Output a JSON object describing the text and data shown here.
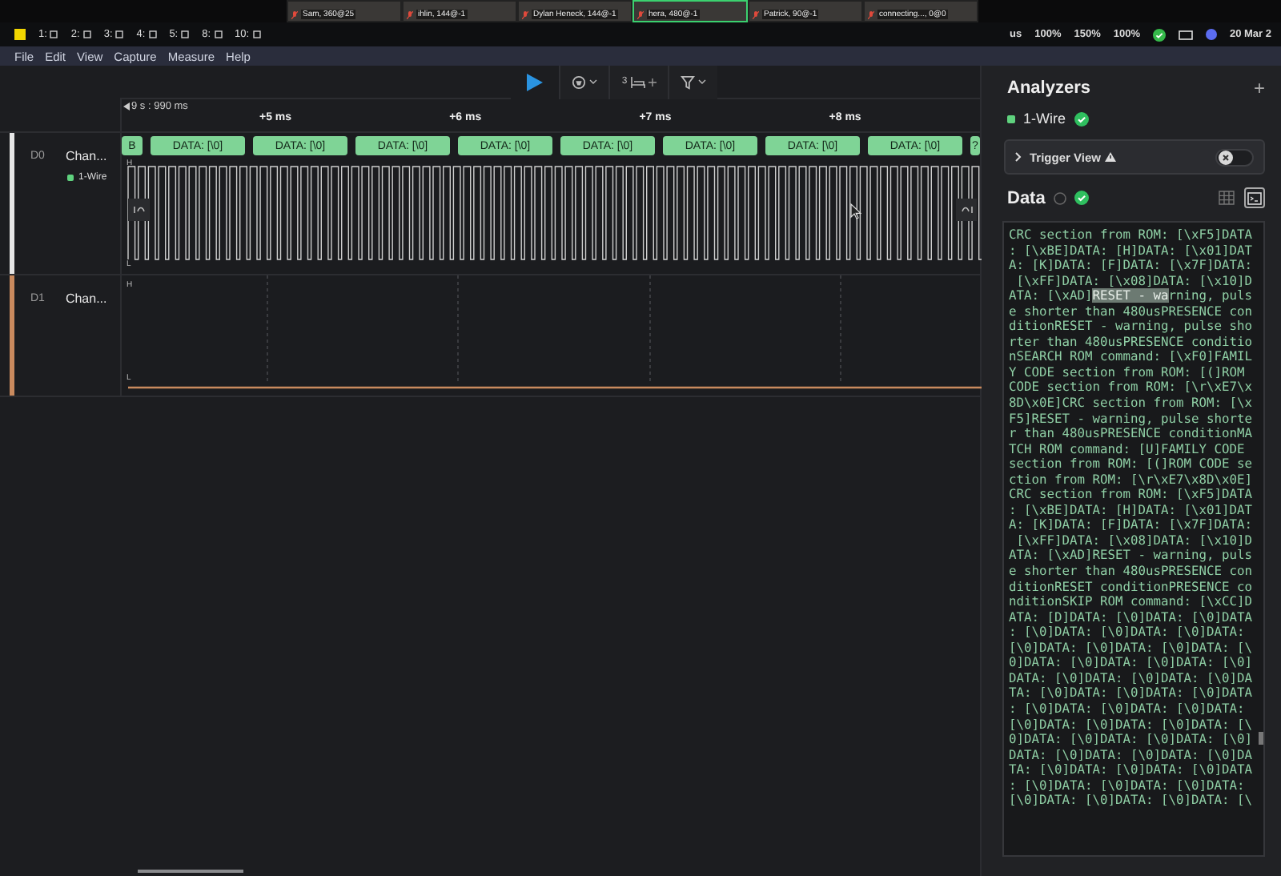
{
  "call_strip": {
    "tiles": [
      {
        "name": "Sam, 360@25",
        "speaking": false
      },
      {
        "name": "ihlin, 144@-1",
        "speaking": false
      },
      {
        "name": "Dylan Heneck, 144@-1",
        "speaking": false
      },
      {
        "name": "hera, 480@-1",
        "speaking": true
      },
      {
        "name": "Patrick, 90@-1",
        "speaking": false
      },
      {
        "name": "connecting..., 0@0",
        "speaking": false
      }
    ]
  },
  "taskbar": {
    "workspaces": [
      {
        "label": "1:"
      },
      {
        "label": "2:"
      },
      {
        "label": "3:"
      },
      {
        "label": "4:"
      },
      {
        "label": "5:"
      },
      {
        "label": "8:"
      },
      {
        "label": "10:"
      }
    ],
    "status": [
      "us",
      "100%",
      "150%",
      "100%"
    ],
    "clock": "20 Mar 2"
  },
  "menu": [
    "File",
    "Edit",
    "View",
    "Capture",
    "Measure",
    "Help"
  ],
  "toolbar": {
    "counter": "3"
  },
  "ruler": {
    "offset": "9 s : 990 ms",
    "ticks": [
      "+5 ms",
      "+6 ms",
      "+7 ms",
      "+8 ms"
    ]
  },
  "channels": [
    {
      "id": "D0",
      "name": "Chan...",
      "color": "#e6e6e6",
      "analyzer": "1-Wire",
      "kind": "pulses",
      "high": "H",
      "low": "L"
    },
    {
      "id": "D1",
      "name": "Chan...",
      "color": "#c98a5e",
      "kind": "flat",
      "high": "H",
      "low": "L"
    }
  ],
  "frames": [
    {
      "label": "B",
      "kind": "partial"
    },
    {
      "label": "DATA: [\\0]",
      "kind": "full"
    },
    {
      "label": "DATA: [\\0]",
      "kind": "full"
    },
    {
      "label": "DATA: [\\0]",
      "kind": "full"
    },
    {
      "label": "DATA: [\\0]",
      "kind": "full"
    },
    {
      "label": "DATA: [\\0]",
      "kind": "full"
    },
    {
      "label": "DATA: [\\0]",
      "kind": "full"
    },
    {
      "label": "DATA: [\\0]",
      "kind": "full"
    },
    {
      "label": "DATA: [\\0]",
      "kind": "full"
    },
    {
      "label": "?",
      "kind": "partial"
    }
  ],
  "analyzers": {
    "title": "Analyzers",
    "add": "+",
    "items": [
      {
        "name": "1-Wire",
        "ok": true
      }
    ],
    "trigger": {
      "label": "Trigger View",
      "on": false
    }
  },
  "data": {
    "title": "Data",
    "ok": true,
    "views": [
      {
        "kind": "table",
        "selected": false
      },
      {
        "kind": "terminal",
        "selected": true
      }
    ],
    "lines": [
      {
        "kind": "plain",
        "text": "CRC section from ROM: [\\xF5]DATA"
      },
      {
        "kind": "plain",
        "text": ": [\\xBE]DATA: [H]DATA: [\\x01]DAT"
      },
      {
        "kind": "plain",
        "text": "A: [K]DATA: [F]DATA: [\\x7F]DATA:"
      },
      {
        "kind": "plain",
        "text": " [\\xFF]DATA: [\\x08]DATA: [\\x10]D"
      },
      {
        "kind": "split",
        "parts": [
          {
            "text": "ATA: [\\xAD]",
            "selected": false
          },
          {
            "text": "RESET - wa",
            "selected": true
          },
          {
            "text": "rning, puls",
            "selected": false
          }
        ]
      },
      {
        "kind": "plain",
        "text": "e shorter than 480usPRESENCE con"
      },
      {
        "kind": "plain",
        "text": "ditionRESET - warning, pulse sho"
      },
      {
        "kind": "plain",
        "text": "rter than 480usPRESENCE conditio"
      },
      {
        "kind": "plain",
        "text": "nSEARCH ROM command: [\\xF0]FAMIL"
      },
      {
        "kind": "plain",
        "text": "Y CODE section from ROM: [(]ROM"
      },
      {
        "kind": "plain",
        "text": "CODE section from ROM: [\\r\\xE7\\x"
      },
      {
        "kind": "plain",
        "text": "8D\\x0E]CRC section from ROM: [\\x"
      },
      {
        "kind": "plain",
        "text": "F5]RESET - warning, pulse shorte"
      },
      {
        "kind": "plain",
        "text": "r than 480usPRESENCE conditionMA"
      },
      {
        "kind": "plain",
        "text": "TCH ROM command: [U]FAMILY CODE"
      },
      {
        "kind": "plain",
        "text": "section from ROM: [(]ROM CODE se"
      },
      {
        "kind": "plain",
        "text": "ction from ROM: [\\r\\xE7\\x8D\\x0E]"
      },
      {
        "kind": "plain",
        "text": "CRC section from ROM: [\\xF5]DATA"
      },
      {
        "kind": "plain",
        "text": ": [\\xBE]DATA: [H]DATA: [\\x01]DAT"
      },
      {
        "kind": "plain",
        "text": "A: [K]DATA: [F]DATA: [\\x7F]DATA:"
      },
      {
        "kind": "plain",
        "text": " [\\xFF]DATA: [\\x08]DATA: [\\x10]D"
      },
      {
        "kind": "plain",
        "text": "ATA: [\\xAD]RESET - warning, puls"
      },
      {
        "kind": "plain",
        "text": "e shorter than 480usPRESENCE con"
      },
      {
        "kind": "plain",
        "text": "ditionRESET conditionPRESENCE co"
      },
      {
        "kind": "plain",
        "text": "nditionSKIP ROM command: [\\xCC]D"
      },
      {
        "kind": "plain",
        "text": "ATA: [D]DATA: [\\0]DATA: [\\0]DATA"
      },
      {
        "kind": "plain",
        "text": ": [\\0]DATA: [\\0]DATA: [\\0]DATA:"
      },
      {
        "kind": "plain",
        "text": "[\\0]DATA: [\\0]DATA: [\\0]DATA: [\\"
      },
      {
        "kind": "plain",
        "text": "0]DATA: [\\0]DATA: [\\0]DATA: [\\0]"
      },
      {
        "kind": "plain",
        "text": "DATA: [\\0]DATA: [\\0]DATA: [\\0]DA"
      },
      {
        "kind": "plain",
        "text": "TA: [\\0]DATA: [\\0]DATA: [\\0]DATA"
      },
      {
        "kind": "plain",
        "text": ": [\\0]DATA: [\\0]DATA: [\\0]DATA:"
      },
      {
        "kind": "plain",
        "text": "[\\0]DATA: [\\0]DATA: [\\0]DATA: [\\"
      },
      {
        "kind": "plain",
        "text": "0]DATA: [\\0]DATA: [\\0]DATA: [\\0]"
      },
      {
        "kind": "plain",
        "text": "DATA: [\\0]DATA: [\\0]DATA: [\\0]DA"
      },
      {
        "kind": "plain",
        "text": "TA: [\\0]DATA: [\\0]DATA: [\\0]DATA"
      },
      {
        "kind": "plain",
        "text": ": [\\0]DATA: [\\0]DATA: [\\0]DATA:"
      },
      {
        "kind": "plain",
        "text": "[\\0]DATA: [\\0]DATA: [\\0]DATA: [\\"
      }
    ]
  }
}
